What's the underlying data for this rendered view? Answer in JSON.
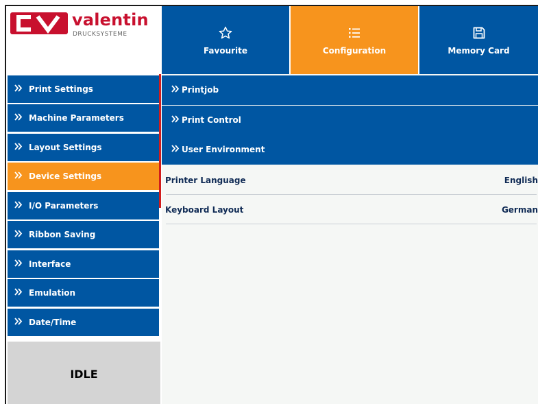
{
  "logo": {
    "name": "valentin",
    "subtitle": "DRUCKSYSTEME",
    "brand_color": "#c8102e"
  },
  "tabs": [
    {
      "label": "Favourite",
      "icon": "star-icon",
      "active": false
    },
    {
      "label": "Configuration",
      "icon": "list-icon",
      "active": true
    },
    {
      "label": "Memory Card",
      "icon": "floppy-disk-icon",
      "active": false
    }
  ],
  "sidebar": {
    "items": [
      {
        "label": "Print Settings"
      },
      {
        "label": "Machine Parameters"
      },
      {
        "label": "Layout Settings"
      },
      {
        "label": "Device Settings",
        "active": true
      },
      {
        "label": "I/O Parameters"
      },
      {
        "label": "Ribbon Saving"
      },
      {
        "label": "Interface"
      },
      {
        "label": "Emulation"
      },
      {
        "label": "Date/Time"
      }
    ]
  },
  "status": {
    "text": "IDLE"
  },
  "main": {
    "groups": [
      {
        "label": "Printjob"
      },
      {
        "label": "Print Control"
      },
      {
        "label": "User Environment"
      }
    ],
    "rows": [
      {
        "label": "Printer Language",
        "value": "English"
      },
      {
        "label": "Keyboard Layout",
        "value": "German"
      }
    ]
  },
  "colors": {
    "primary_blue": "#0056a2",
    "accent_orange": "#f7941d",
    "status_gray": "#d4d4d4"
  }
}
